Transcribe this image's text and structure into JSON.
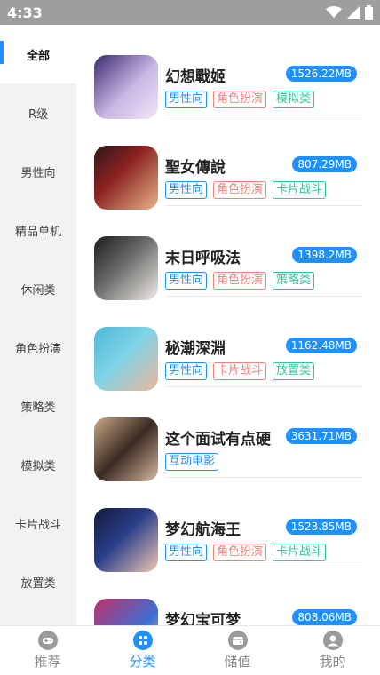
{
  "status_bar": {
    "time": "4:33"
  },
  "sidebar": {
    "items": [
      {
        "label": "全部",
        "active": true
      },
      {
        "label": "R级"
      },
      {
        "label": "男性向"
      },
      {
        "label": "精品单机"
      },
      {
        "label": "休闲类"
      },
      {
        "label": "角色扮演"
      },
      {
        "label": "策略类"
      },
      {
        "label": "模拟类"
      },
      {
        "label": "卡片战斗"
      },
      {
        "label": "放置类"
      }
    ]
  },
  "games": [
    {
      "title": "幻想戰姬",
      "size": "1526.22MB",
      "tags": [
        {
          "text": "男性向",
          "color": "blue"
        },
        {
          "text": "角色扮演",
          "color": "red"
        },
        {
          "text": "模拟类",
          "color": "green"
        }
      ]
    },
    {
      "title": "聖女傳說",
      "size": "807.29MB",
      "tags": [
        {
          "text": "男性向",
          "color": "blue"
        },
        {
          "text": "角色扮演",
          "color": "red"
        },
        {
          "text": "卡片战斗",
          "color": "green"
        }
      ]
    },
    {
      "title": "末日呼吸法",
      "size": "1398.2MB",
      "tags": [
        {
          "text": "男性向",
          "color": "blue"
        },
        {
          "text": "角色扮演",
          "color": "red"
        },
        {
          "text": "策略类",
          "color": "green"
        }
      ]
    },
    {
      "title": "秘潮深淵",
      "size": "1162.48MB",
      "tags": [
        {
          "text": "男性向",
          "color": "blue"
        },
        {
          "text": "卡片战斗",
          "color": "red"
        },
        {
          "text": "放置类",
          "color": "green"
        }
      ]
    },
    {
      "title": "这个面试有点硬",
      "size": "3631.71MB",
      "tags": [
        {
          "text": "互动电影",
          "color": "blue"
        }
      ]
    },
    {
      "title": "梦幻航海王",
      "size": "1523.85MB",
      "tags": [
        {
          "text": "男性向",
          "color": "blue"
        },
        {
          "text": "角色扮演",
          "color": "red"
        },
        {
          "text": "卡片战斗",
          "color": "green"
        }
      ]
    },
    {
      "title": "梦幻宝可梦",
      "size": "808.06MB",
      "tags": []
    }
  ],
  "bottom_nav": [
    {
      "label": "推荐",
      "icon": "gamepad-icon"
    },
    {
      "label": "分类",
      "icon": "category-icon",
      "active": true
    },
    {
      "label": "储值",
      "icon": "wallet-icon"
    },
    {
      "label": "我的",
      "icon": "profile-icon"
    }
  ],
  "colors": {
    "accent": "#1e90ff",
    "tag_red": "#f4827a",
    "tag_green": "#2fc49a",
    "status_bar": "#9e9e9e"
  }
}
